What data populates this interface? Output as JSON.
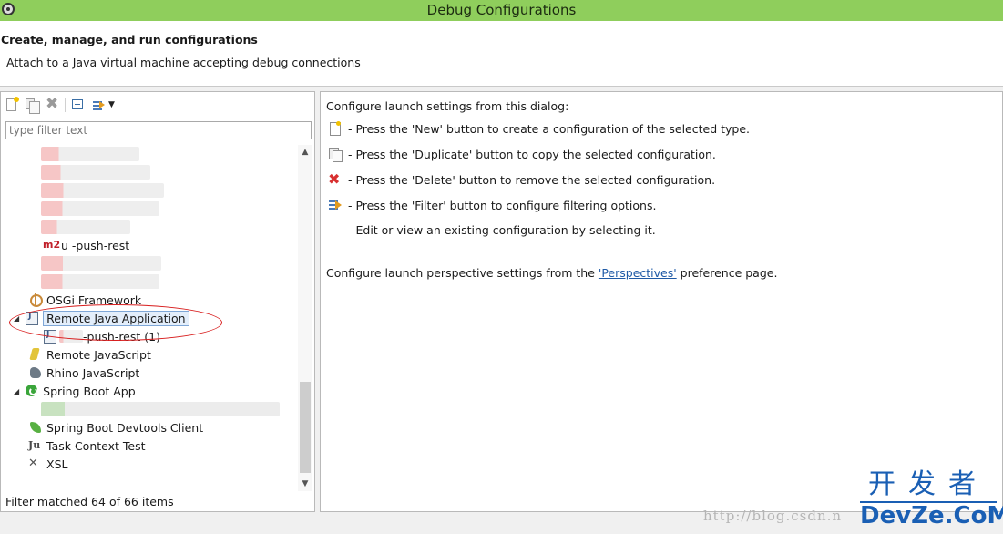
{
  "window": {
    "title": "Debug Configurations"
  },
  "header": {
    "title": "Create, manage, and run configurations",
    "message": "Attach to a Java virtual machine accepting debug connections"
  },
  "toolbar": {
    "icons": [
      "new-config-icon",
      "duplicate-icon",
      "delete-icon",
      "collapse-all-icon",
      "filter-icon",
      "dropdown-arrow-icon"
    ]
  },
  "filter": {
    "placeholder": "type filter text"
  },
  "tree": {
    "m2_item_label": "u    -push-rest",
    "items": [
      {
        "label": "OSGi Framework",
        "icon": "osgi-icon"
      },
      {
        "label": "Remote Java Application",
        "icon": "remote-java-app-icon",
        "expanded": true,
        "selected": true
      },
      {
        "label": "-push-rest (1)",
        "icon": "java-config-icon"
      },
      {
        "label": "Remote JavaScript",
        "icon": "remote-javascript-icon"
      },
      {
        "label": "Rhino JavaScript",
        "icon": "rhino-icon"
      },
      {
        "label": "Spring Boot App",
        "icon": "spring-boot-icon",
        "expanded": true
      },
      {
        "label": "Spring Boot Devtools Client",
        "icon": "spring-devtools-icon"
      },
      {
        "label": "Task Context Test",
        "icon": "task-context-icon"
      },
      {
        "label": "XSL",
        "icon": "xsl-icon"
      }
    ]
  },
  "status": {
    "text": "Filter matched 64 of 66 items"
  },
  "right": {
    "intro": "Configure launch settings from this dialog:",
    "lines": [
      "- Press the 'New' button to create a configuration of the selected type.",
      "- Press the 'Duplicate' button to copy the selected configuration.",
      "- Press the 'Delete' button to remove the selected configuration.",
      "- Press the 'Filter' button to configure filtering options.",
      "- Edit or view an existing configuration by selecting it."
    ],
    "perspective_prefix": "Configure launch perspective settings from the ",
    "perspective_link": "'Perspectives'",
    "perspective_suffix": " preference page."
  },
  "watermark": {
    "url": "http://blog.csdn.n",
    "logo_cn": "开发者",
    "logo_en": "DevZe.CoM"
  },
  "colors": {
    "titlebar": "#8fce5c",
    "highlight_ellipse": "#d81e1e",
    "link": "#1f5aa6"
  }
}
